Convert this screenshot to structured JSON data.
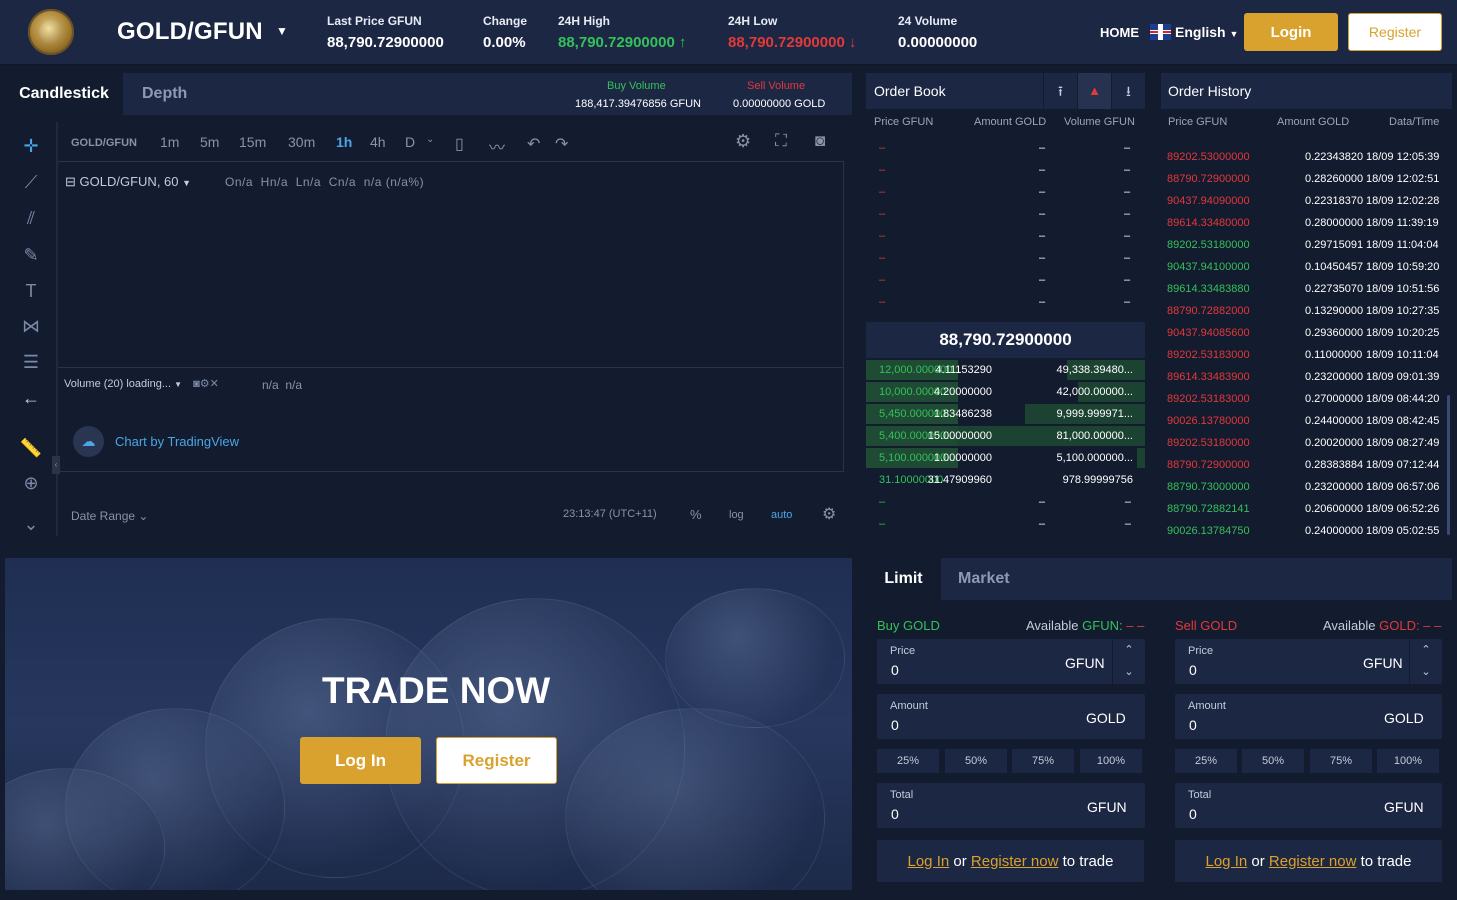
{
  "header": {
    "pair": "GOLD/GFUN",
    "stats": [
      {
        "label": "Last Price GFUN",
        "value": "88,790.72900000",
        "color": "#ffffff"
      },
      {
        "label": "Change",
        "value": "0.00%",
        "color": "#ffffff"
      },
      {
        "label": "24H High",
        "value": "88,790.72900000",
        "color": "#35c15a"
      },
      {
        "label": "24H Low",
        "value": "88,790.72900000",
        "color": "#e2393a"
      },
      {
        "label": "24 Volume",
        "value": "0.00000000",
        "color": "#ffffff"
      }
    ],
    "home": "HOME",
    "language": "English",
    "login": "Login",
    "register": "Register"
  },
  "chart": {
    "tabs": [
      "Candlestick",
      "Depth"
    ],
    "buy_volume_label": "Buy Volume",
    "buy_volume_value": "188,417.39476856 GFUN",
    "sell_volume_label": "Sell Volume",
    "sell_volume_value": "0.00000000 GOLD",
    "symbol": "GOLD/GFUN",
    "timeframes": [
      "1m",
      "5m",
      "15m",
      "30m",
      "1h",
      "4h",
      "D"
    ],
    "active_timeframe": "1h",
    "legend": "GOLD/GFUN, 60",
    "ohlc": "On/a  Hn/a  Ln/a  Cn/a  n/a (n/a%)",
    "volume_legend": "Volume (20) loading...",
    "volume_values": "n/a  n/a",
    "watermark": "Chart by TradingView",
    "date_range": "Date Range",
    "time": "23:13:47 (UTC+11)",
    "percent": "%",
    "log": "log",
    "auto": "auto"
  },
  "order_book": {
    "title": "Order Book",
    "columns": [
      "Price GFUN",
      "Amount GOLD",
      "Volume GFUN"
    ],
    "last_price": "88,790.72900000",
    "asks_count_label": "–",
    "bids": [
      {
        "price": "12,000.000000...",
        "amount": "4.11153290",
        "volume": "49,338.39480...",
        "depth": 0.28
      },
      {
        "price": "10,000.00000...",
        "amount": "4.20000000",
        "volume": "42,000.00000...",
        "depth": 0.24
      },
      {
        "price": "5,450.000000...",
        "amount": "1.83486238",
        "volume": "9,999.999971...",
        "depth": 0.43
      },
      {
        "price": "5,400.000000...",
        "amount": "15.00000000",
        "volume": "81,000.00000...",
        "depth": 0.7
      },
      {
        "price": "5,100.000000...",
        "amount": "1.00000000",
        "volume": "5,100.000000...",
        "depth": 0.03
      },
      {
        "price": "31.10000000",
        "amount": "31.47909960",
        "volume": "978.99999756",
        "depth": 0
      },
      {
        "price": "–",
        "amount": "–",
        "volume": "–",
        "depth": 0
      },
      {
        "price": "–",
        "amount": "–",
        "volume": "–",
        "depth": 0
      }
    ]
  },
  "order_history": {
    "title": "Order History",
    "columns": [
      "Price GFUN",
      "Amount GOLD",
      "Data/Time"
    ],
    "rows": [
      {
        "price": "89202.53000000",
        "amount": "0.22343820",
        "time": "18/09 12:05:39",
        "side": "red"
      },
      {
        "price": "88790.72900000",
        "amount": "0.28260000",
        "time": "18/09 12:02:51",
        "side": "red"
      },
      {
        "price": "90437.94090000",
        "amount": "0.22318370",
        "time": "18/09 12:02:28",
        "side": "red"
      },
      {
        "price": "89614.33480000",
        "amount": "0.28000000",
        "time": "18/09 11:39:19",
        "side": "red"
      },
      {
        "price": "89202.53180000",
        "amount": "0.29715091",
        "time": "18/09 11:04:04",
        "side": "green"
      },
      {
        "price": "90437.94100000",
        "amount": "0.10450457",
        "time": "18/09 10:59:20",
        "side": "green"
      },
      {
        "price": "89614.33483880",
        "amount": "0.22735070",
        "time": "18/09 10:51:56",
        "side": "green"
      },
      {
        "price": "88790.72882000",
        "amount": "0.13290000",
        "time": "18/09 10:27:35",
        "side": "red"
      },
      {
        "price": "90437.94085600",
        "amount": "0.29360000",
        "time": "18/09 10:20:25",
        "side": "red"
      },
      {
        "price": "89202.53183000",
        "amount": "0.11000000",
        "time": "18/09 10:11:04",
        "side": "red"
      },
      {
        "price": "89614.33483900",
        "amount": "0.23200000",
        "time": "18/09 09:01:39",
        "side": "red"
      },
      {
        "price": "89202.53183000",
        "amount": "0.27000000",
        "time": "18/09 08:44:20",
        "side": "red"
      },
      {
        "price": "90026.13780000",
        "amount": "0.24400000",
        "time": "18/09 08:42:45",
        "side": "red"
      },
      {
        "price": "89202.53180000",
        "amount": "0.20020000",
        "time": "18/09 08:27:49",
        "side": "red"
      },
      {
        "price": "88790.72900000",
        "amount": "0.28383884",
        "time": "18/09 07:12:44",
        "side": "red"
      },
      {
        "price": "88790.73000000",
        "amount": "0.23200000",
        "time": "18/09 06:57:06",
        "side": "green"
      },
      {
        "price": "88790.72882141",
        "amount": "0.20600000",
        "time": "18/09 06:52:26",
        "side": "green"
      },
      {
        "price": "90026.13784750",
        "amount": "0.24000000",
        "time": "18/09 05:02:55",
        "side": "green"
      }
    ]
  },
  "promo": {
    "title": "TRADE NOW",
    "login": "Log In",
    "register": "Register"
  },
  "trade_form": {
    "tabs": [
      "Limit",
      "Market"
    ],
    "buy": {
      "title": "Buy GOLD",
      "available_label": "Available",
      "available_currency": "GFUN:",
      "available_value": "– –",
      "price_label": "Price",
      "price_value": "0",
      "price_unit": "GFUN",
      "amount_label": "Amount",
      "amount_value": "0",
      "amount_unit": "GOLD",
      "total_label": "Total",
      "total_value": "0",
      "total_unit": "GFUN",
      "percents": [
        "25%",
        "50%",
        "75%",
        "100%"
      ],
      "login": "Log In",
      "or": "or",
      "register": "Register now",
      "to_trade": "to trade"
    },
    "sell": {
      "title": "Sell GOLD",
      "available_label": "Available",
      "available_currency": "GOLD:",
      "available_value": "– –",
      "price_label": "Price",
      "price_value": "0",
      "price_unit": "GFUN",
      "amount_label": "Amount",
      "amount_value": "0",
      "amount_unit": "GOLD",
      "total_label": "Total",
      "total_value": "0",
      "total_unit": "GFUN",
      "percents": [
        "25%",
        "50%",
        "75%",
        "100%"
      ],
      "login": "Log In",
      "or": "or",
      "register": "Register now",
      "to_trade": "to trade"
    }
  },
  "colors": {
    "accent": "#d9a22e",
    "buy": "#35c15a",
    "sell": "#e2393a",
    "panel": "#1c2744",
    "bg": "#131b2e"
  }
}
